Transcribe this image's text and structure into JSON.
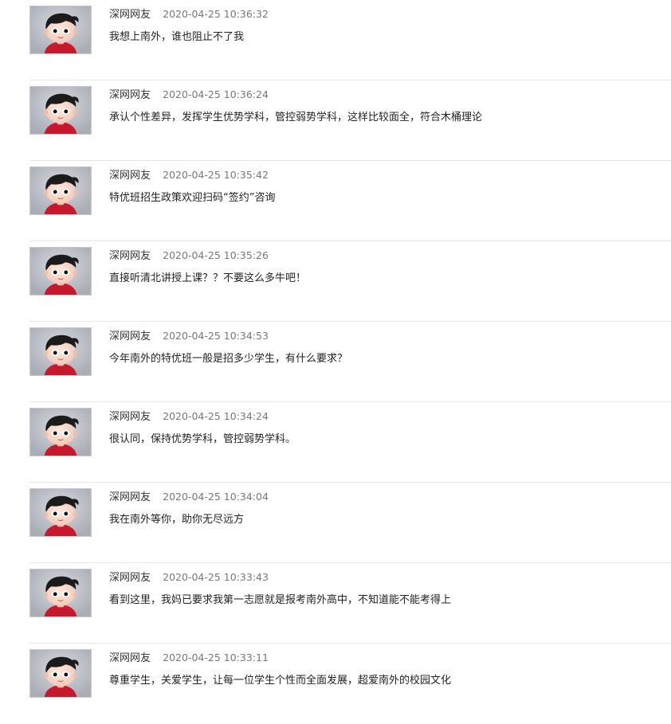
{
  "comments": [
    {
      "author": "深网网友",
      "time": "2020-04-25 10:36:32",
      "text": "我想上南外，谁也阻止不了我"
    },
    {
      "author": "深网网友",
      "time": "2020-04-25 10:36:24",
      "text": "承认个性差异，发挥学生优势学科，管控弱势学科，这样比较面全，符合木桶理论"
    },
    {
      "author": "深网网友",
      "time": "2020-04-25 10:35:42",
      "text": "特优班招生政策欢迎扫码“签约”咨询"
    },
    {
      "author": "深网网友",
      "time": "2020-04-25 10:35:26",
      "text": "直接听清北讲授上课？？不要这么多牛吧！"
    },
    {
      "author": "深网网友",
      "time": "2020-04-25 10:34:53",
      "text": "今年南外的特优班一般是招多少学生，有什么要求？"
    },
    {
      "author": "深网网友",
      "time": "2020-04-25 10:34:24",
      "text": "很认同，保持优势学科，管控弱势学科。"
    },
    {
      "author": "深网网友",
      "time": "2020-04-25 10:34:04",
      "text": "我在南外等你，助你无尽远方"
    },
    {
      "author": "深网网友",
      "time": "2020-04-25 10:33:43",
      "text": "看到这里，我妈已要求我第一志愿就是报考南外高中，不知道能不能考得上"
    },
    {
      "author": "深网网友",
      "time": "2020-04-25 10:33:11",
      "text": "尊重学生，关爱学生，让每一位学生个性而全面发展，超爱南外的校园文化"
    }
  ],
  "avatar_icon": "default-user-avatar-icon",
  "colors": {
    "divider": "#e6e6e6",
    "timestamp": "#777777",
    "avatar_bg": "#c0c3c8"
  }
}
